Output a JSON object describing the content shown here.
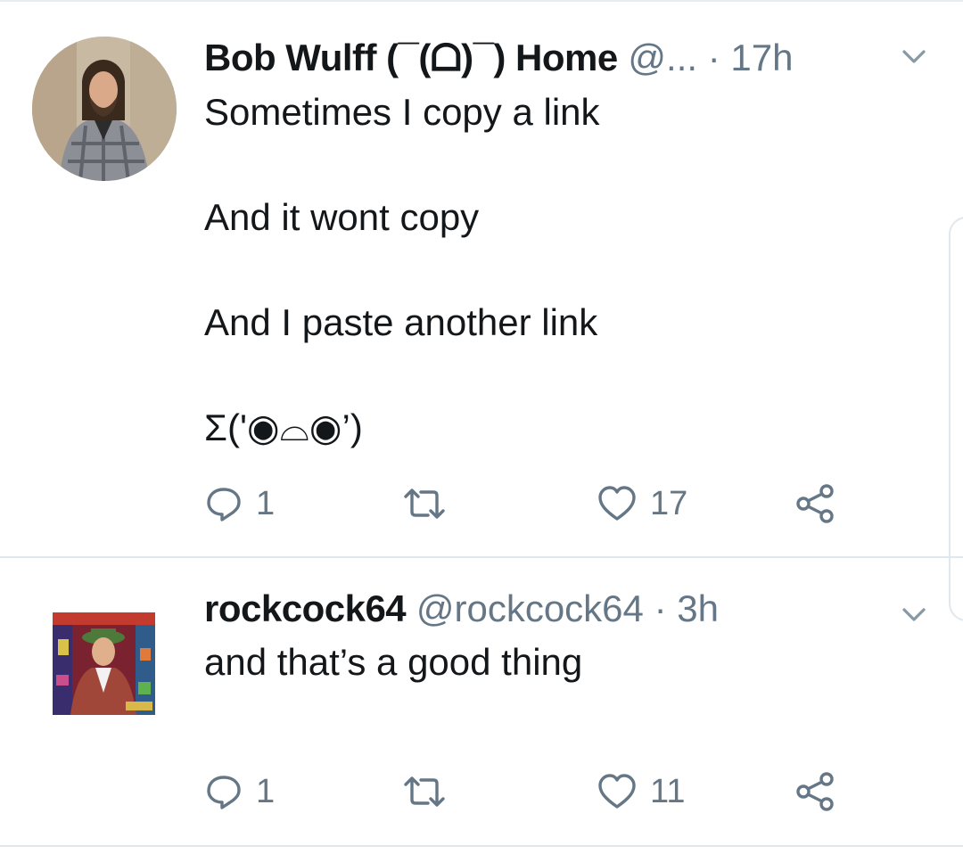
{
  "tweets": [
    {
      "author_name": "Bob Wulff (¯(ᗝ)¯) Home",
      "handle": "@...",
      "separator": "·",
      "time": "17h",
      "text_lines": [
        "Sometimes I copy a link",
        "",
        "And it wont copy",
        "",
        "And I paste another link",
        "",
        "Σ('◉⌓◉’)"
      ],
      "text": "Sometimes I copy a link\n\nAnd it wont copy\n\nAnd I paste another link\n\nΣ('◉⌓◉’)",
      "replies": "1",
      "retweets": "",
      "likes": "17",
      "avatar_icon": "user-photo-avatar"
    },
    {
      "author_name": "rockcock64",
      "handle": "@rockcock64",
      "separator": "·",
      "time": "3h",
      "text": "and that’s a good thing",
      "replies": "1",
      "retweets": "",
      "likes": "11",
      "avatar_icon": "album-cover-avatar"
    }
  ],
  "icons": {
    "reply": "reply-icon",
    "retweet": "retweet-icon",
    "like": "heart-icon",
    "share": "share-icon",
    "caret": "chevron-down-icon"
  },
  "colors": {
    "text": "#14171a",
    "secondary": "#657786",
    "divider": "#e1e8ed",
    "background": "#ffffff"
  }
}
